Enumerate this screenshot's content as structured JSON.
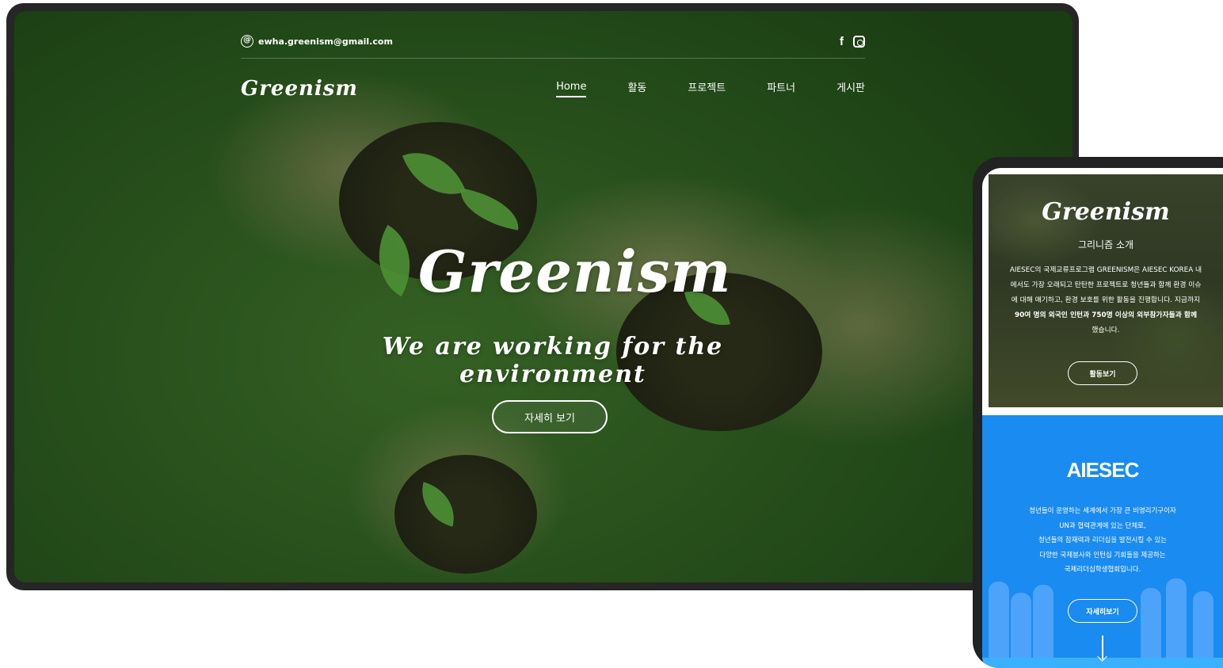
{
  "desktop": {
    "email": "ewha.greenism@gmail.com",
    "social_icons": [
      "facebook-icon",
      "instagram-icon"
    ],
    "logo": "Greenism",
    "nav": [
      {
        "label": "Home",
        "active": true
      },
      {
        "label": "활동",
        "active": false
      },
      {
        "label": "프로젝트",
        "active": false
      },
      {
        "label": "파트너",
        "active": false
      },
      {
        "label": "게시판",
        "active": false
      }
    ],
    "hero": {
      "logo": "Greenism",
      "tagline": "We are working for the environment",
      "button": "자세히 보기"
    }
  },
  "mobile": {
    "intro": {
      "logo": "Greenism",
      "subtitle": "그리니즘 소개",
      "description_lines": [
        "AIESEC의 국제교류프로그램 GREENISM은 AIESEC KOREA 내",
        "에서도 가장 오래되고 탄탄한 프로젝트로 청년들과 함께 환경 이슈",
        "에 대해 얘기하고, 환경 보호를 위한 활동을 진행합니다. 지금까지",
        "90여 명의 외국인 인턴과 750명 이상의 외부참가자들과 함께",
        "했습니다."
      ],
      "button": "활동보기"
    },
    "aiesec": {
      "title": "AIESEC",
      "description_lines": [
        "청년들이 운영하는 세계에서 가장 큰 비영리기구이자",
        "UN과 협력관계에 있는 단체로,",
        "청년들의 잠재력과 리더십을 발전시킬 수 있는",
        "다양한 국제봉사와 인턴십 기회들을 제공하는",
        "국제리더십학생협회입니다."
      ],
      "button": "자세히보기"
    }
  },
  "colors": {
    "aiesec_blue": "#1a8bf0",
    "device_frame": "#262626",
    "hero_green": "#3f6e2a"
  }
}
